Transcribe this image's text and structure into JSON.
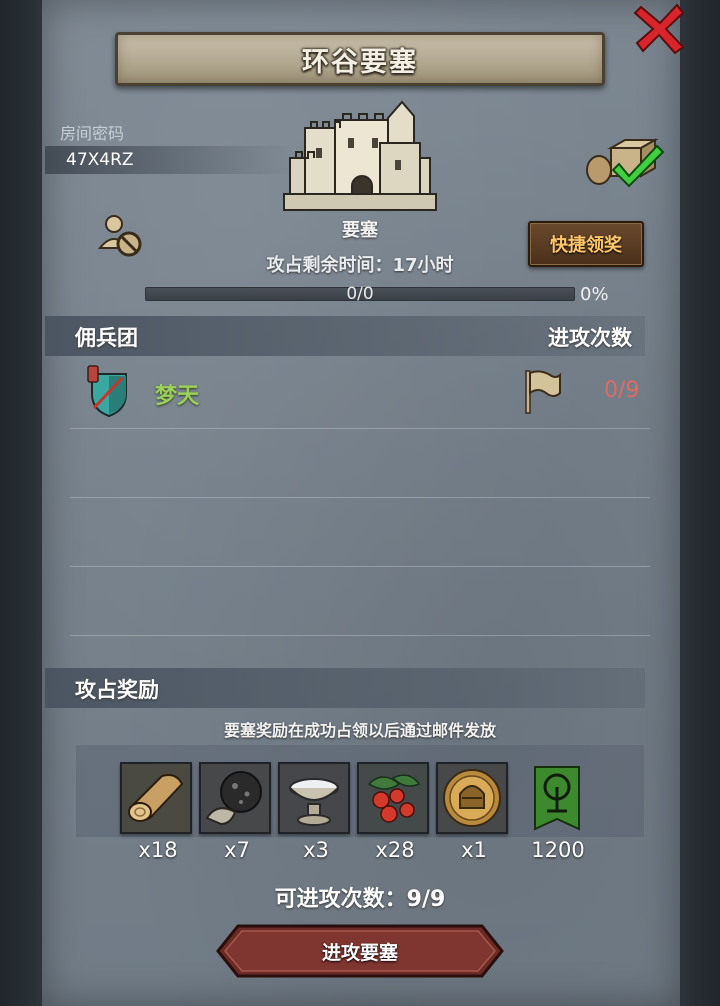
{
  "title": "环谷要塞",
  "room": {
    "label": "房间密码",
    "code": "47X4RZ"
  },
  "fortress": {
    "label": "要塞",
    "remain_time": "攻占剩余时间：17小时"
  },
  "quick_claim_label": "快捷领奖",
  "progress": {
    "text": "0/0",
    "percent_text": "0%",
    "fraction": 0
  },
  "mercenary": {
    "header_left": "佣兵团",
    "header_right": "进攻次数",
    "members": [
      {
        "name": "梦天",
        "attacks": "0/9"
      }
    ]
  },
  "rewards": {
    "header": "攻占奖励",
    "note": "要塞奖励在成功占领以后通过邮件发放",
    "items": [
      {
        "icon": "wood-log-icon",
        "count": "x18"
      },
      {
        "icon": "stone-ore-icon",
        "count": "x7"
      },
      {
        "icon": "salt-bowl-icon",
        "count": "x3"
      },
      {
        "icon": "berries-icon",
        "count": "x28"
      },
      {
        "icon": "knight-helmet-coin-icon",
        "count": "x1"
      },
      {
        "icon": "tree-banner-icon",
        "count": "1200"
      }
    ]
  },
  "attacks_left": "可进攻次数：9/9",
  "attack_button_label": "进攻要塞",
  "colors": {
    "member_name": "#9bd05a",
    "attack_count": "#e06a62",
    "claim_text": "#ffc76a",
    "close_x": "#d8242a"
  }
}
